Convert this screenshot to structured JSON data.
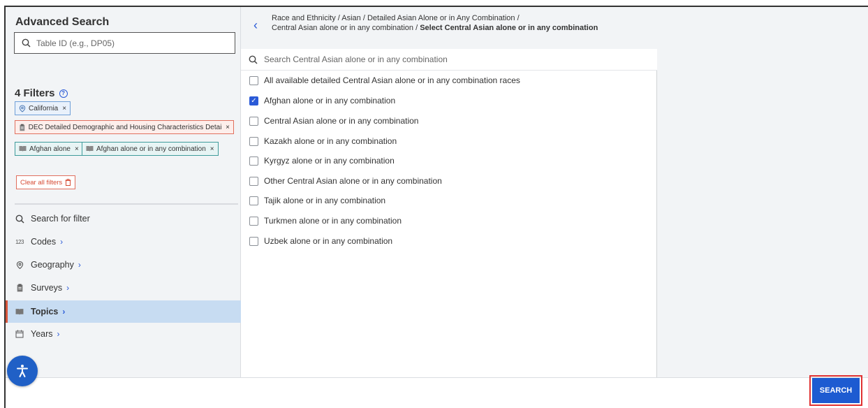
{
  "left_panel": {
    "title": "Advanced Search",
    "table_id_placeholder": "Table ID (e.g., DP05)",
    "filters_title": "4 Filters",
    "chips": {
      "geo": "California",
      "survey": "DEC Detailed Demographic and Housing Characteristics Detail...",
      "topic1": "Afghan alone",
      "topic2": "Afghan alone or in any combination"
    },
    "clear_all": "Clear all filters",
    "nav": [
      {
        "label": "Search for filter",
        "icon": "search-icon"
      },
      {
        "label": "Codes",
        "icon": "codes-icon"
      },
      {
        "label": "Geography",
        "icon": "location-pin-icon"
      },
      {
        "label": "Surveys",
        "icon": "clipboard-icon"
      },
      {
        "label": "Topics",
        "icon": "book-icon",
        "active": true
      },
      {
        "label": "Years",
        "icon": "calendar-icon"
      }
    ]
  },
  "middle_panel": {
    "breadcrumb_line1": "Race and Ethnicity / Asian / Detailed Asian Alone or in Any Combination /",
    "breadcrumb_line2_prefix": "Central Asian alone or in any combination / ",
    "breadcrumb_line2_current": "Select Central Asian alone or in any combination",
    "search_placeholder": "Search Central Asian alone or in any combination",
    "options": [
      {
        "label": "All available detailed Central Asian alone or in any combination races",
        "checked": false
      },
      {
        "label": "Afghan alone or in any combination",
        "checked": true
      },
      {
        "label": "Central Asian alone or in any combination",
        "checked": false
      },
      {
        "label": "Kazakh alone or in any combination",
        "checked": false
      },
      {
        "label": "Kyrgyz alone or in any combination",
        "checked": false
      },
      {
        "label": "Other Central Asian alone or in any combination",
        "checked": false
      },
      {
        "label": "Tajik alone or in any combination",
        "checked": false
      },
      {
        "label": "Turkmen alone or in any combination",
        "checked": false
      },
      {
        "label": "Uzbek alone or in any combination",
        "checked": false
      }
    ]
  },
  "bottom_bar": {
    "search_button": "SEARCH"
  },
  "colors": {
    "accent_blue": "#2a5ad7",
    "search_highlight": "#e03232",
    "active_nav_bg": "#c7dcf2"
  }
}
